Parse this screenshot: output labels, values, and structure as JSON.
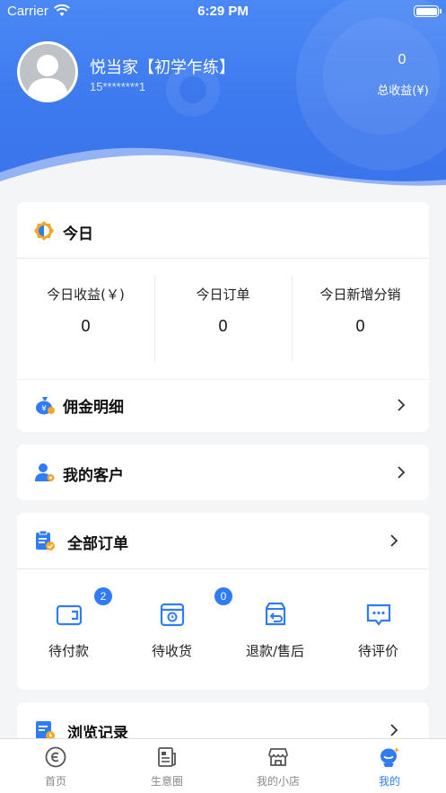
{
  "status_bar": {
    "carrier": "Carrier",
    "time": "6:29 PM"
  },
  "profile": {
    "name": "悦当家【初学乍练】",
    "phone": "15********1",
    "total_income_value": "0",
    "total_income_label": "总收益(¥)"
  },
  "today": {
    "title": "今日",
    "stats": [
      {
        "label": "今日收益(￥)",
        "value": "0"
      },
      {
        "label": "今日订单",
        "value": "0"
      },
      {
        "label": "今日新增分销",
        "value": "0"
      }
    ],
    "commission_label": "佣金明细"
  },
  "customers": {
    "label": "我的客户"
  },
  "orders": {
    "title": "全部订单",
    "items": [
      {
        "label": "待付款",
        "badge": "2",
        "icon": "wallet-icon"
      },
      {
        "label": "待收货",
        "badge": "0",
        "icon": "delivery-box-icon"
      },
      {
        "label": "退款/售后",
        "badge": "",
        "icon": "refund-icon"
      },
      {
        "label": "待评价",
        "badge": "",
        "icon": "comment-icon"
      }
    ]
  },
  "history": {
    "label": "浏览记录"
  },
  "tabbar": {
    "items": [
      {
        "label": "首页",
        "icon": "home-icon"
      },
      {
        "label": "生意圈",
        "icon": "newspaper-icon"
      },
      {
        "label": "我的小店",
        "icon": "shop-icon"
      },
      {
        "label": "我的",
        "icon": "profile-icon"
      }
    ],
    "active_index": 3
  },
  "colors": {
    "accent": "#2f7cf6",
    "header": "#3c78ee",
    "orange": "#f5a623"
  }
}
